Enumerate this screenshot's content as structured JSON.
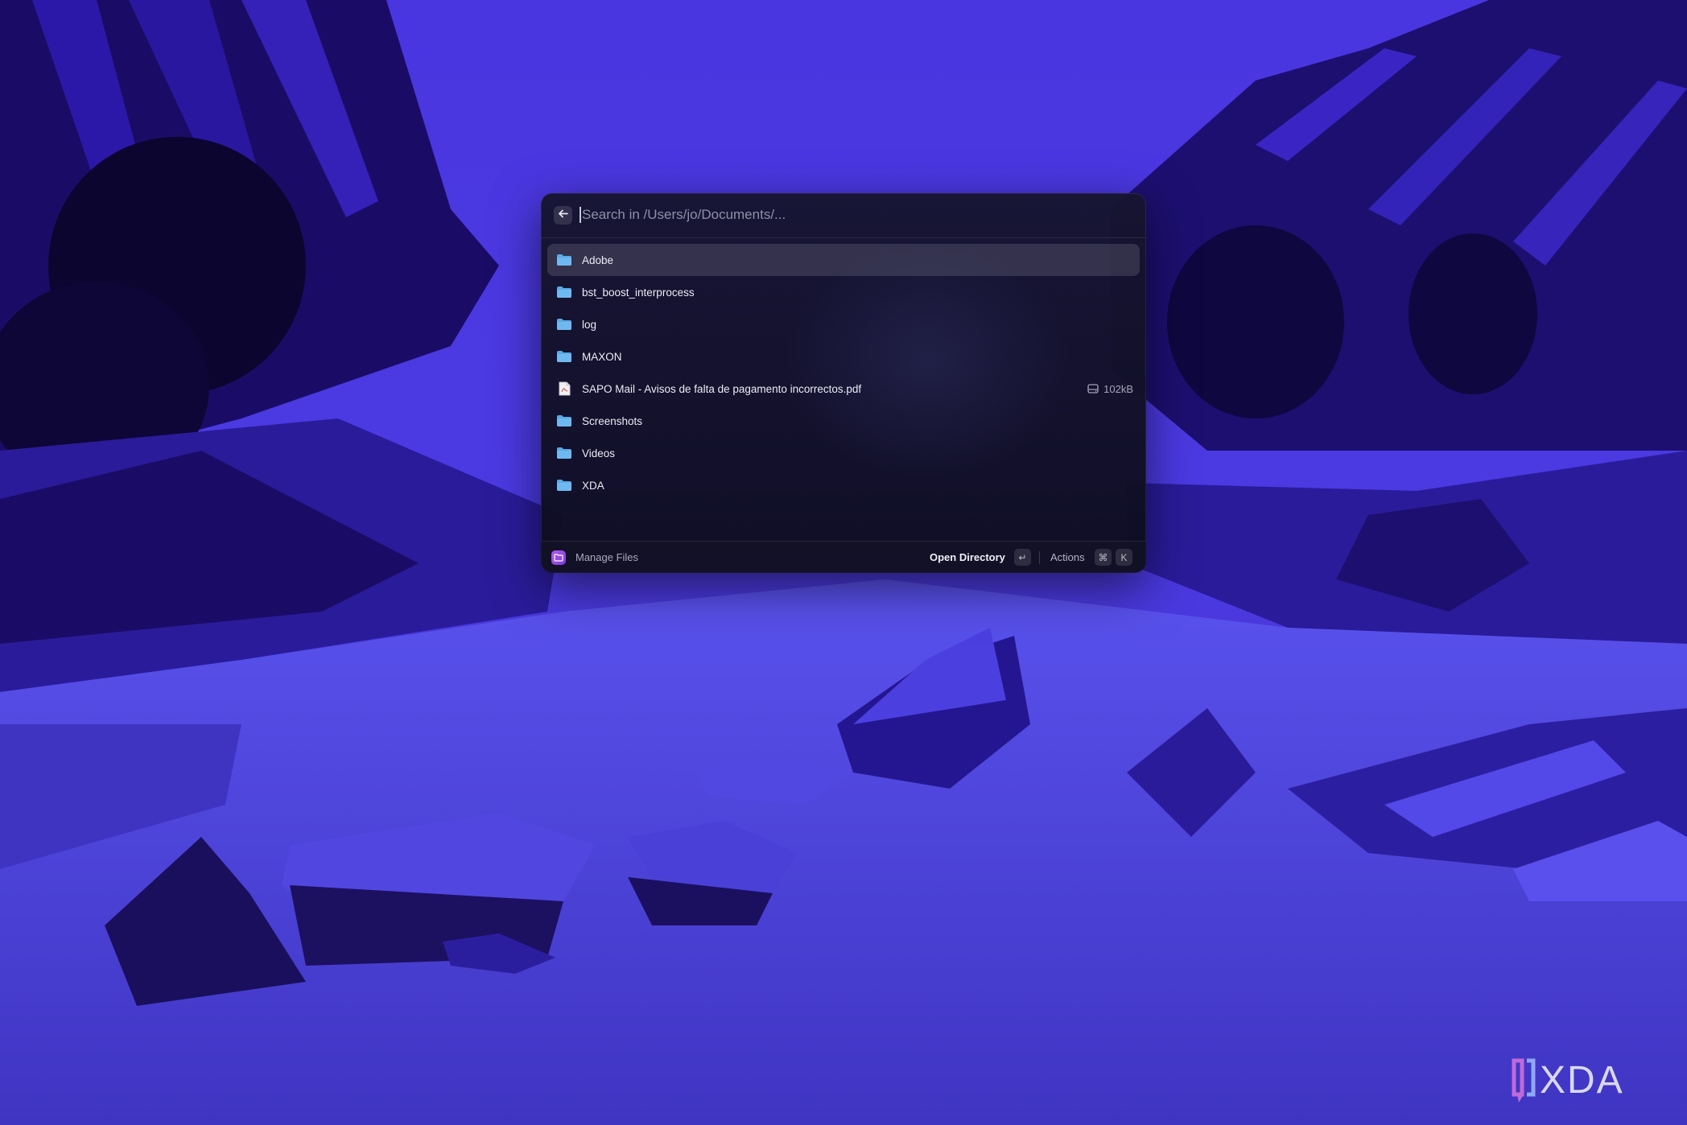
{
  "search": {
    "placeholder": "Search in /Users/jo/Documents/...",
    "back_icon": "arrow-left-icon"
  },
  "files": [
    {
      "name": "Adobe",
      "kind": "folder",
      "selected": true
    },
    {
      "name": "bst_boost_interprocess",
      "kind": "folder"
    },
    {
      "name": "log",
      "kind": "folder"
    },
    {
      "name": "MAXON",
      "kind": "folder"
    },
    {
      "name": "SAPO Mail - Avisos de falta de pagamento incorrectos.pdf",
      "kind": "file",
      "size": "102kB"
    },
    {
      "name": "Screenshots",
      "kind": "folder"
    },
    {
      "name": "Videos",
      "kind": "folder"
    },
    {
      "name": "XDA",
      "kind": "folder"
    }
  ],
  "footer": {
    "app_label": "Manage Files",
    "primary_action": "Open Directory",
    "primary_shortcut": "↵",
    "actions_label": "Actions",
    "actions_shortcut": [
      "⌘",
      "K"
    ]
  },
  "watermark": {
    "text": "XDA"
  },
  "colors": {
    "folder": "#5aa9e6",
    "accent": "#9b4fe6",
    "wallpaper": "#4a38d8"
  }
}
